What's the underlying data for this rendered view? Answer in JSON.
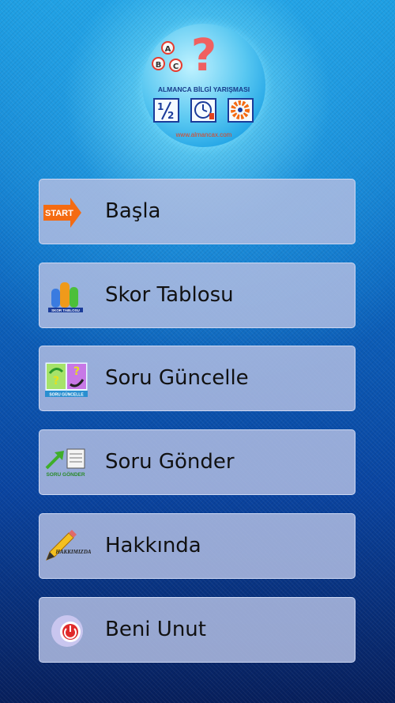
{
  "logo": {
    "balls": [
      "A",
      "B",
      "C"
    ],
    "question_mark": "?",
    "title": "ALMANCA BİLGİ YARIŞMASI",
    "fraction": "1/2",
    "url": "www.almancax.com"
  },
  "menu": [
    {
      "label": "Başla",
      "icon": "start-arrow-icon",
      "icon_text": "START"
    },
    {
      "label": "Skor Tablosu",
      "icon": "bar-chart-icon",
      "icon_text": "SKOR TABLOSU"
    },
    {
      "label": "Soru Güncelle",
      "icon": "refresh-questions-icon",
      "icon_text": "SORU GÜNCELLE"
    },
    {
      "label": "Soru Gönder",
      "icon": "send-question-icon",
      "icon_text": "SORU GÖNDER"
    },
    {
      "label": "Hakkında",
      "icon": "pencil-icon",
      "icon_text": "HAKKIMIZDA"
    },
    {
      "label": "Beni Unut",
      "icon": "power-icon",
      "icon_text": ""
    }
  ],
  "colors": {
    "start_orange": "#f46b12",
    "question_pink": "#f06060",
    "button_bg": "#afbce1"
  }
}
